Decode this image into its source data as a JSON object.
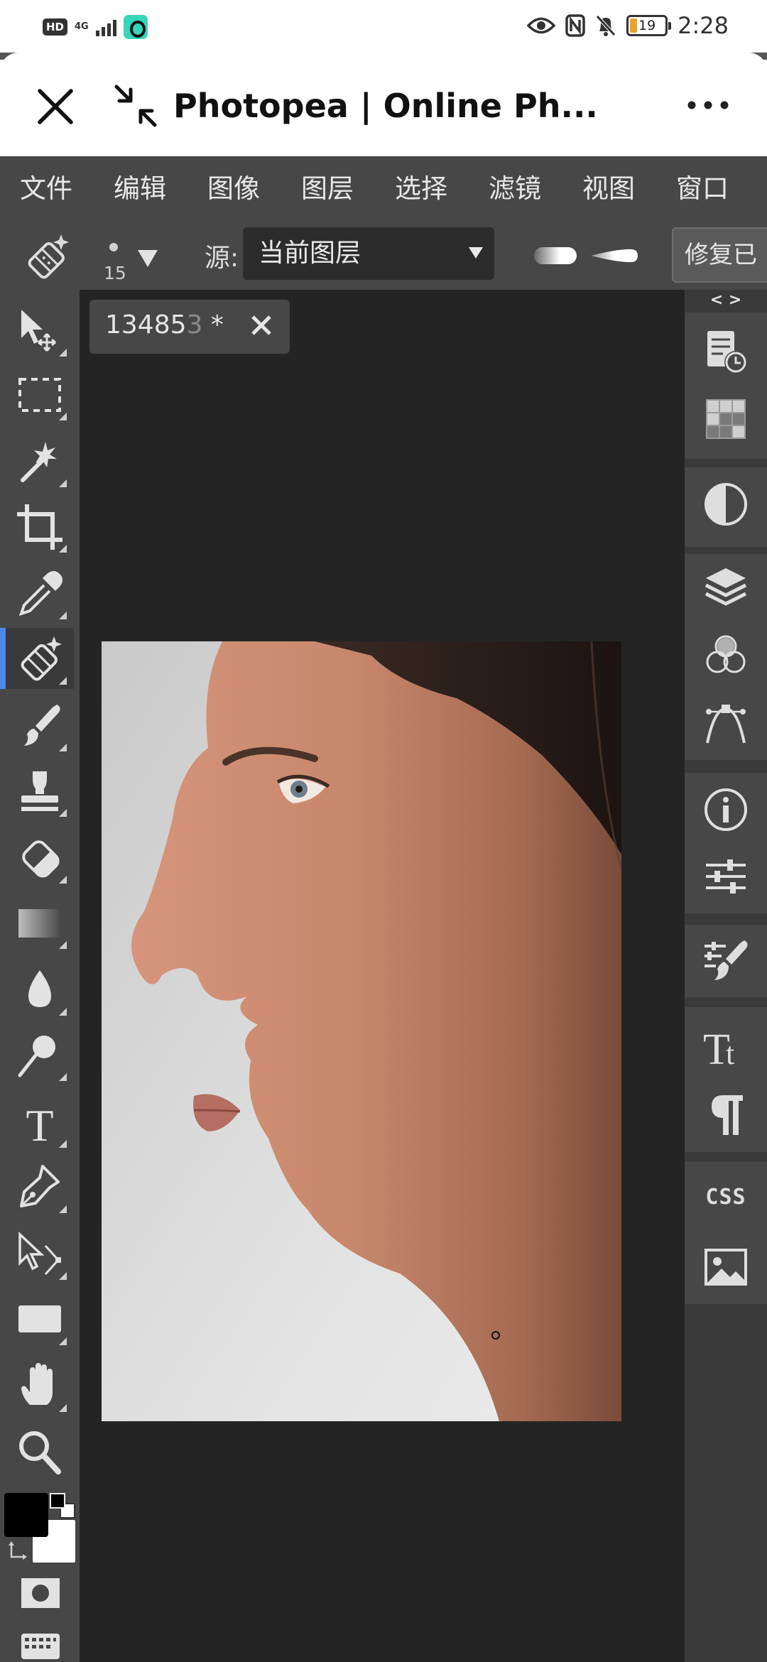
{
  "status_bar": {
    "hd": "HD",
    "network": "4G",
    "battery": "19",
    "battery_level": 0.19,
    "time": "2:28"
  },
  "browser": {
    "title": "Photopea | Online Ph...",
    "close_icon": "close-icon",
    "shrink_icon": "exit-fullscreen-icon",
    "more_icon": "more-icon"
  },
  "menu": [
    "文件",
    "编辑",
    "图像",
    "图层",
    "选择",
    "滤镜",
    "视图",
    "窗口"
  ],
  "options": {
    "brush_size": "15",
    "source_label": "源:",
    "source_value": "当前图层",
    "repair_button": "修复已"
  },
  "document": {
    "tab_name_main": "13485",
    "tab_name_faded": "3",
    "tab_modified": " *"
  },
  "right_panel": {
    "collapse_arrows": "< >",
    "css_label": "CSS"
  },
  "colors": {
    "app_bg": "#474747",
    "canvas_bg": "#242424",
    "accent": "#4b87e8",
    "foreground_swatch": "#000000",
    "background_swatch": "#ffffff"
  }
}
